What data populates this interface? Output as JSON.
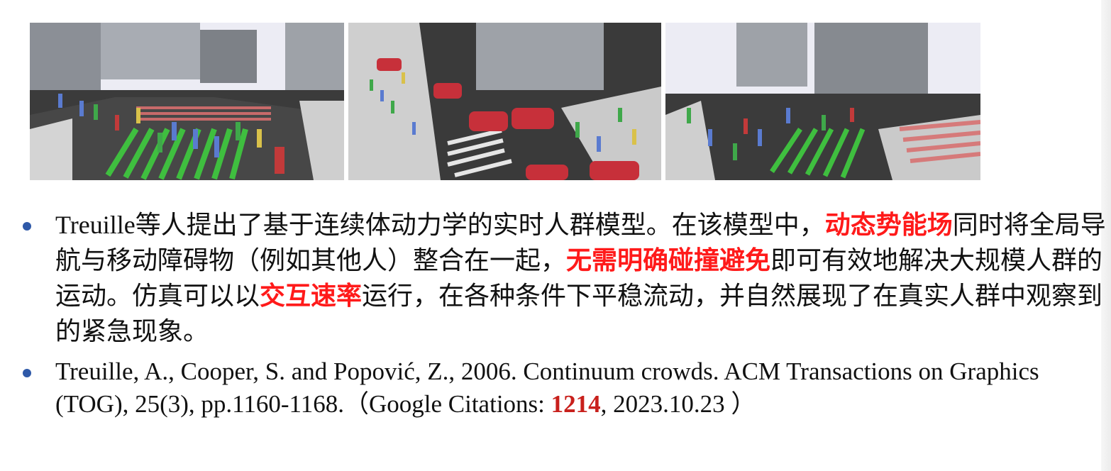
{
  "images": [
    {
      "name": "crowd-scene-left"
    },
    {
      "name": "crowd-scene-middle"
    },
    {
      "name": "crowd-scene-right"
    }
  ],
  "bullet1": {
    "lead_latin": "Treuille",
    "part1": "等人提出了基于连续体动力学的实时人群模型。在该模型中，",
    "hl1": "动态势能场",
    "part2": "同时将全局导航与移动障碍物（例如其他人）整合在一起，",
    "hl2": "无需明确碰撞避免",
    "part3": "即可有效地解决大规模人群的运动。仿真可以以",
    "hl3": "交互速率",
    "part4": "运行，在各种条件下平稳流动，并自然展现了在真实人群中观察到的紧急现象。"
  },
  "bullet2": {
    "part1": "Treuille, A., Cooper, S. and Popović, Z., 2006. Continuum crowds. ACM Transactions on Graphics (TOG), 25(3), pp.1160-1168.（Google Citations: ",
    "citations": "1214",
    "part2": ", 2023.10.23 ）"
  },
  "colors": {
    "highlight": "#ff1a1a",
    "citation_number": "#c8201c",
    "bullet_dot": "#2f59a8"
  }
}
